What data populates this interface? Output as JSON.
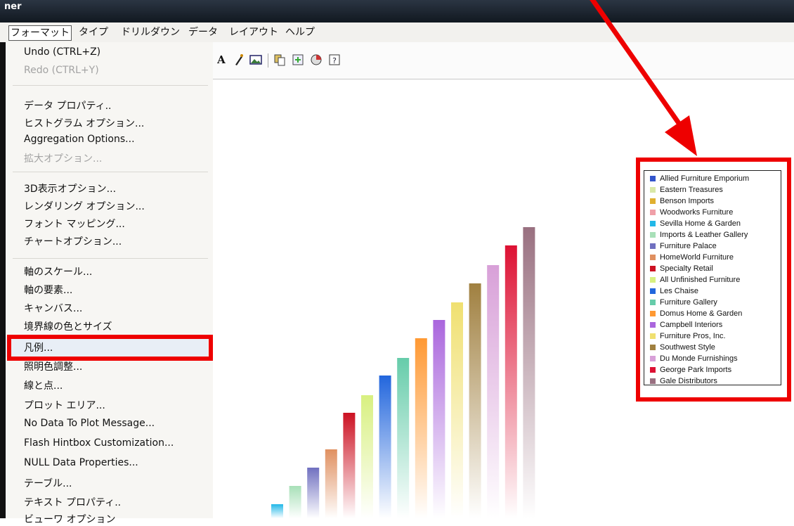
{
  "window": {
    "title": "ner"
  },
  "menubar": {
    "items": [
      "フォーマット",
      "タイプ",
      "ドリルダウン",
      "データ",
      "レイアウト",
      "ヘルプ"
    ]
  },
  "dropdown": {
    "items": [
      {
        "label": "Undo (CTRL+Z)",
        "disabled": false
      },
      {
        "label": "Redo (CTRL+Y)",
        "disabled": true
      },
      {
        "label": "データ プロパティ..",
        "disabled": false
      },
      {
        "label": "ヒストグラム オプション...",
        "disabled": false
      },
      {
        "label": "Aggregation Options...",
        "disabled": false
      },
      {
        "label": "拡大オプション...",
        "disabled": true
      },
      {
        "label": "3D表示オプション...",
        "disabled": false
      },
      {
        "label": "レンダリング オプション...",
        "disabled": false
      },
      {
        "label": "フォント マッピング...",
        "disabled": false
      },
      {
        "label": "チャートオプション...",
        "disabled": false
      },
      {
        "label": "軸のスケール...",
        "disabled": false
      },
      {
        "label": "軸の要素...",
        "disabled": false
      },
      {
        "label": "キャンバス...",
        "disabled": false
      },
      {
        "label": "境界線の色とサイズ",
        "disabled": false
      },
      {
        "label": "凡例...",
        "disabled": false
      },
      {
        "label": "照明色調整...",
        "disabled": false
      },
      {
        "label": "線と点...",
        "disabled": false
      },
      {
        "label": "プロット エリア...",
        "disabled": false
      },
      {
        "label": "No Data To Plot Message...",
        "disabled": false
      },
      {
        "label": "Flash Hintbox Customization...",
        "disabled": false
      },
      {
        "label": "NULL Data Properties...",
        "disabled": false
      },
      {
        "label": "テーブル...",
        "disabled": false
      },
      {
        "label": "テキスト プロパティ..",
        "disabled": false
      },
      {
        "label": "ビューワ オプション",
        "disabled": false
      }
    ]
  },
  "toolbar": {
    "icons": [
      "text-icon",
      "pen-icon",
      "image-icon",
      "copy-icon",
      "export-icon",
      "chart-icon",
      "help-icon"
    ]
  },
  "legend": {
    "items": [
      {
        "label": "Allied Furniture Emporium",
        "color": "#3355cc"
      },
      {
        "label": "Eastern Treasures",
        "color": "#d9e8a8"
      },
      {
        "label": "Benson Imports",
        "color": "#e0b030"
      },
      {
        "label": "Woodworks Furniture",
        "color": "#f0a0a8"
      },
      {
        "label": "Sevilla Home & Garden",
        "color": "#22b8e8"
      },
      {
        "label": "Imports & Leather Gallery",
        "color": "#a8e0b8"
      },
      {
        "label": "Furniture Palace",
        "color": "#7070c0"
      },
      {
        "label": "HomeWorld Furniture",
        "color": "#e09060"
      },
      {
        "label": "Specialty Retail",
        "color": "#cc1122"
      },
      {
        "label": "All Unfinished Furniture",
        "color": "#d8f080"
      },
      {
        "label": "Les Chaise",
        "color": "#2266dd"
      },
      {
        "label": "Furniture Gallery",
        "color": "#66ccaa"
      },
      {
        "label": "Domus Home & Garden",
        "color": "#ff9933"
      },
      {
        "label": "Campbell Interiors",
        "color": "#aa66dd"
      },
      {
        "label": "Furniture Pros, Inc.",
        "color": "#f0e070"
      },
      {
        "label": "Southwest Style",
        "color": "#a08040"
      },
      {
        "label": "Du Monde Furnishings",
        "color": "#d8a0d8"
      },
      {
        "label": "George Park Imports",
        "color": "#dd1133"
      },
      {
        "label": "Gale Distributors",
        "color": "#997080"
      }
    ]
  },
  "chart_data": {
    "type": "bar",
    "categories": [
      "Sevilla Home & Garden",
      "Imports & Leather Gallery",
      "Furniture Palace",
      "HomeWorld Furniture",
      "Specialty Retail",
      "All Unfinished Furniture",
      "Les Chaise",
      "Furniture Gallery",
      "Domus Home & Garden",
      "Campbell Interiors",
      "Furniture Pros, Inc.",
      "Southwest Style",
      "Du Monde Furnishings",
      "George Park Imports",
      "Gale Distributors"
    ],
    "values": [
      20,
      46,
      72,
      98,
      150,
      175,
      203,
      228,
      256,
      282,
      307,
      334,
      360,
      388,
      414
    ],
    "colors": [
      "#22b8e8",
      "#a8e0b8",
      "#7070c0",
      "#e09060",
      "#cc1122",
      "#d8f080",
      "#2266dd",
      "#66ccaa",
      "#ff9933",
      "#aa66dd",
      "#f0e070",
      "#a08040",
      "#d8a0d8",
      "#dd1133",
      "#997080"
    ],
    "ylim": [
      0,
      414
    ]
  }
}
